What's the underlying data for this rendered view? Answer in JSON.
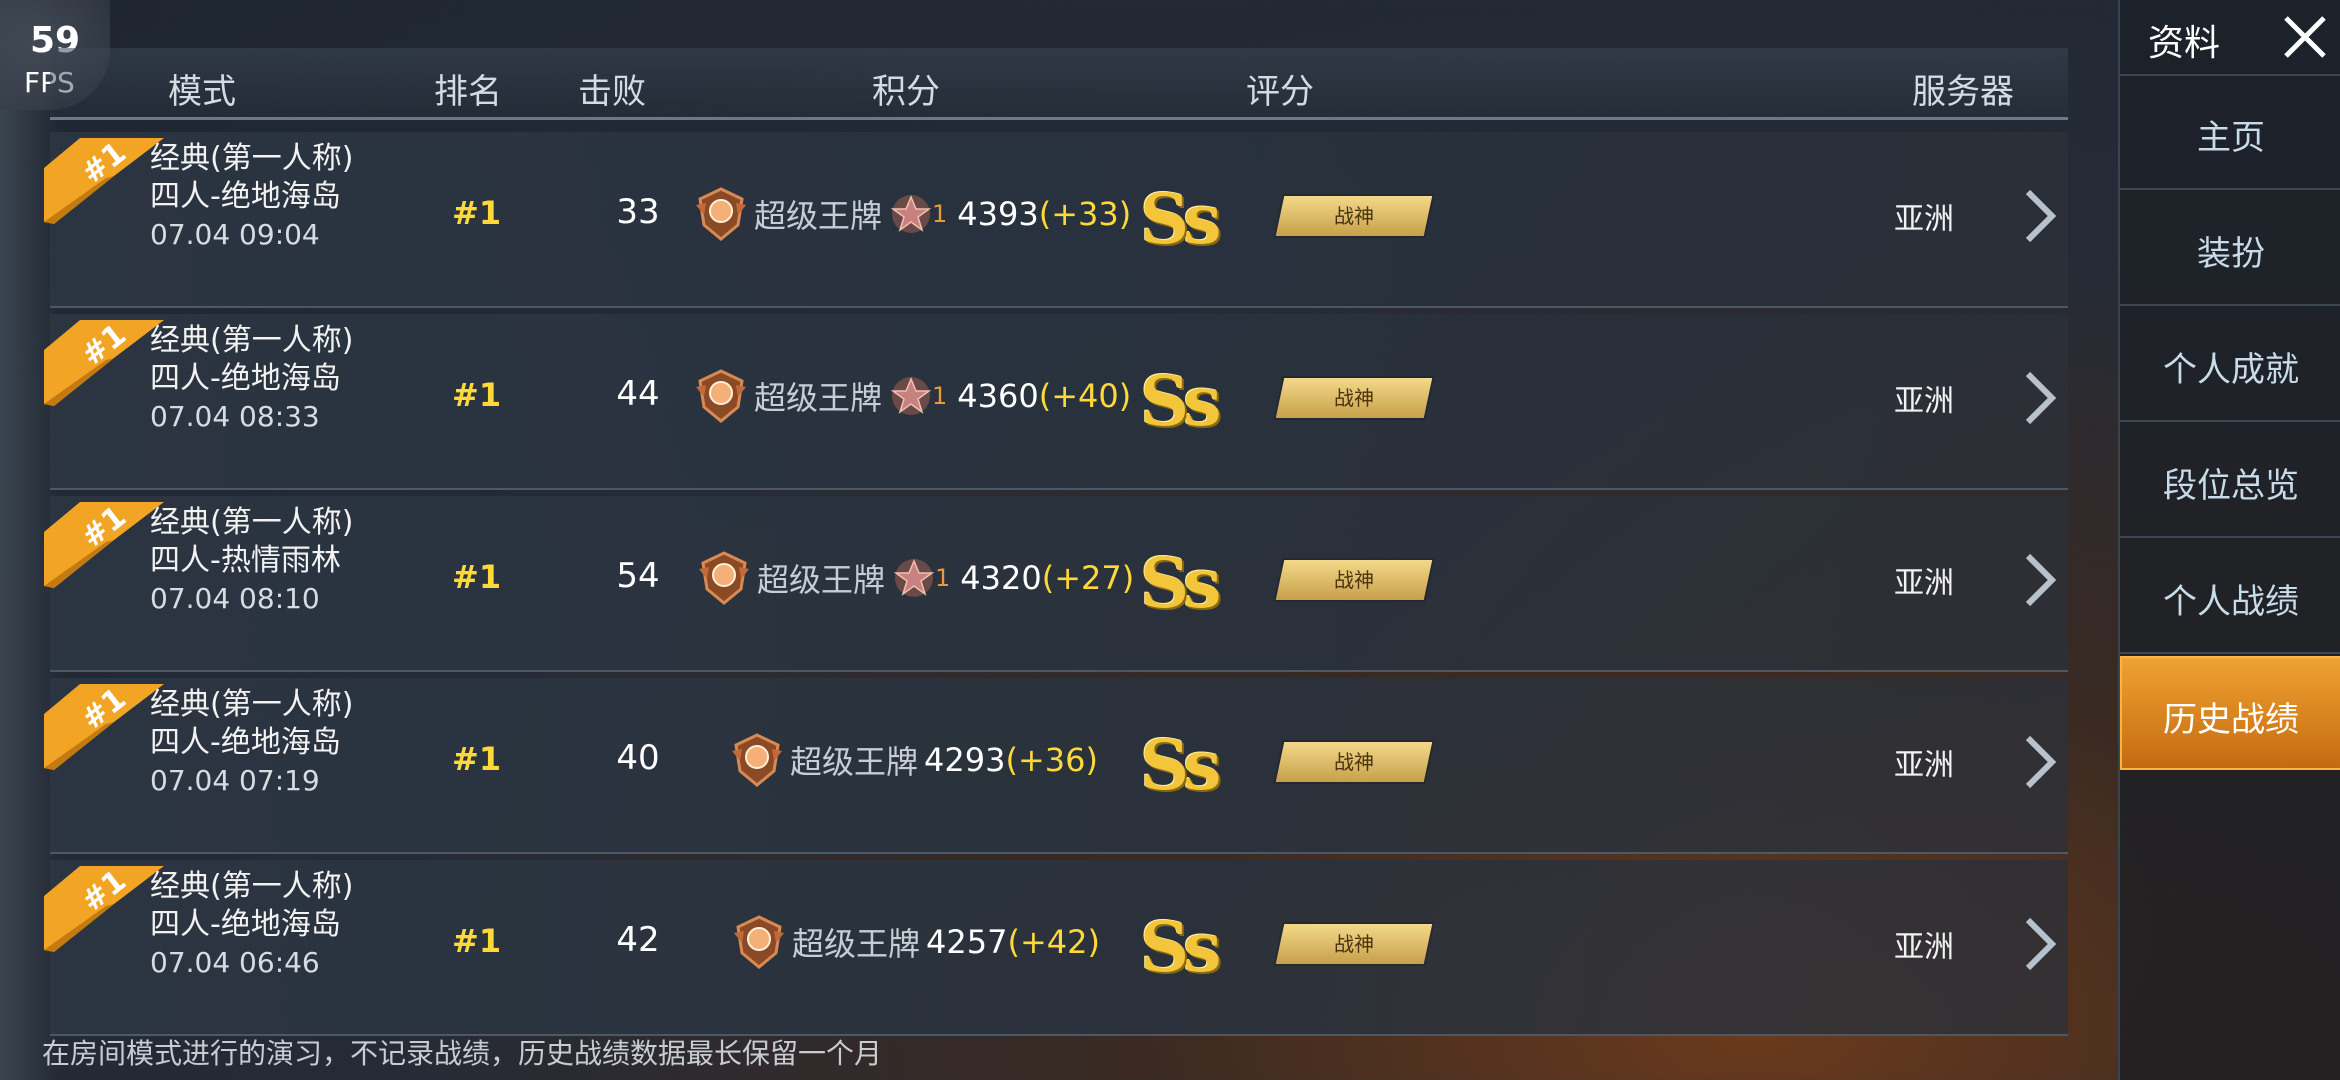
{
  "fps": {
    "value": "59",
    "label": "FPS"
  },
  "header": {
    "mode": "模式",
    "rank": "排名",
    "kills": "击败",
    "score": "积分",
    "rating": "评分",
    "server": "服务器"
  },
  "rows": [
    {
      "badge": "#1",
      "mode_line1": "经典(第一人称)",
      "mode_line2": "四人-绝地海岛",
      "date": "07.04 09:04",
      "rank": "#1",
      "kills": "33",
      "tier": "超级王牌",
      "star_level": "1",
      "points": "4393",
      "delta": "(+33)",
      "grade": "Ss",
      "title": "战神",
      "server": "亚洲",
      "has_star": true
    },
    {
      "badge": "#1",
      "mode_line1": "经典(第一人称)",
      "mode_line2": "四人-绝地海岛",
      "date": "07.04 08:33",
      "rank": "#1",
      "kills": "44",
      "tier": "超级王牌",
      "star_level": "1",
      "points": "4360",
      "delta": "(+40)",
      "grade": "Ss",
      "title": "战神",
      "server": "亚洲",
      "has_star": true
    },
    {
      "badge": "#1",
      "mode_line1": "经典(第一人称)",
      "mode_line2": "四人-热情雨林",
      "date": "07.04 08:10",
      "rank": "#1",
      "kills": "54",
      "tier": "超级王牌",
      "star_level": "1",
      "points": "4320",
      "delta": "(+27)",
      "grade": "Ss",
      "title": "战神",
      "server": "亚洲",
      "has_star": true
    },
    {
      "badge": "#1",
      "mode_line1": "经典(第一人称)",
      "mode_line2": "四人-绝地海岛",
      "date": "07.04 07:19",
      "rank": "#1",
      "kills": "40",
      "tier": "超级王牌",
      "star_level": "",
      "points": "4293",
      "delta": "(+36)",
      "grade": "Ss",
      "title": "战神",
      "server": "亚洲",
      "has_star": false
    },
    {
      "badge": "#1",
      "mode_line1": "经典(第一人称)",
      "mode_line2": "四人-绝地海岛",
      "date": "07.04 06:46",
      "rank": "#1",
      "kills": "42",
      "tier": "超级王牌",
      "star_level": "",
      "points": "4257",
      "delta": "(+42)",
      "grade": "Ss",
      "title": "战神",
      "server": "亚洲",
      "has_star": false
    }
  ],
  "footnote": "在房间模式进行的演习，不记录战绩，历史战绩数据最长保留一个月",
  "sidebar": {
    "title": "资料",
    "items": [
      {
        "label": "主页",
        "active": false
      },
      {
        "label": "装扮",
        "active": false
      },
      {
        "label": "个人成就",
        "active": false
      },
      {
        "label": "段位总览",
        "active": false
      },
      {
        "label": "个人战绩",
        "active": false
      },
      {
        "label": "历史战绩",
        "active": true
      }
    ]
  },
  "colors": {
    "accent": "#f0a232",
    "highlight": "#ffd83a",
    "badge": "#f2a524"
  }
}
